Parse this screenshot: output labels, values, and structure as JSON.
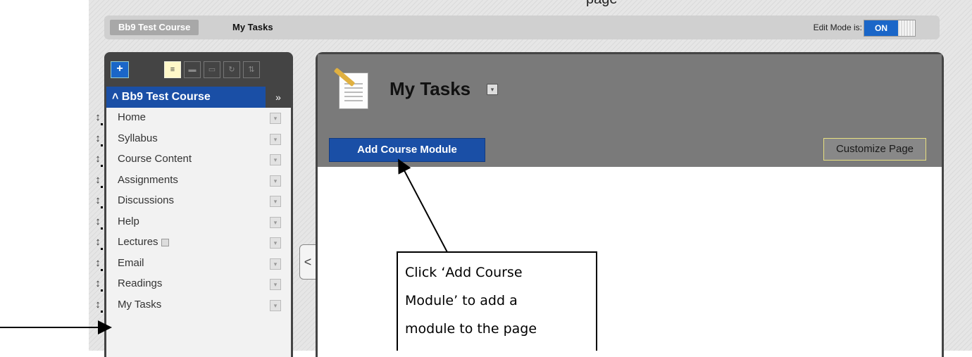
{
  "top_partial_text": "page",
  "breadcrumb": {
    "course": "Bb9 Test Course",
    "page": "My Tasks"
  },
  "edit_mode": {
    "label": "Edit Mode is:",
    "state": "ON"
  },
  "course_menu": {
    "course_title": "Bb9 Test Course",
    "collapse_glyph": "»",
    "title_glyph": "≈",
    "items": [
      {
        "label": "Home"
      },
      {
        "label": "Syllabus"
      },
      {
        "label": "Course Content"
      },
      {
        "label": "Assignments"
      },
      {
        "label": "Discussions"
      },
      {
        "label": "Help"
      },
      {
        "label": "Lectures"
      },
      {
        "label": "Email"
      },
      {
        "label": "Readings"
      },
      {
        "label": "My Tasks"
      }
    ]
  },
  "content": {
    "page_title": "My Tasks",
    "add_module_label": "Add Course Module",
    "customize_label": "Customize Page"
  },
  "callout": {
    "lines": [
      "Click ‘Add Course",
      "Module’ to add a",
      "module to the page"
    ]
  },
  "colors": {
    "primary_blue": "#1a4fa6",
    "toggle_blue": "#1a66c8",
    "header_gray": "#7a7a7a",
    "frame_dark": "#444444"
  },
  "icons": [
    "plus-icon",
    "list-view-icon",
    "folder-icon",
    "window-icon",
    "refresh-icon",
    "manage-icon",
    "drag-handle-icon",
    "chevron-down-icon",
    "page-pencil-icon",
    "collapse-arrow-icon"
  ]
}
